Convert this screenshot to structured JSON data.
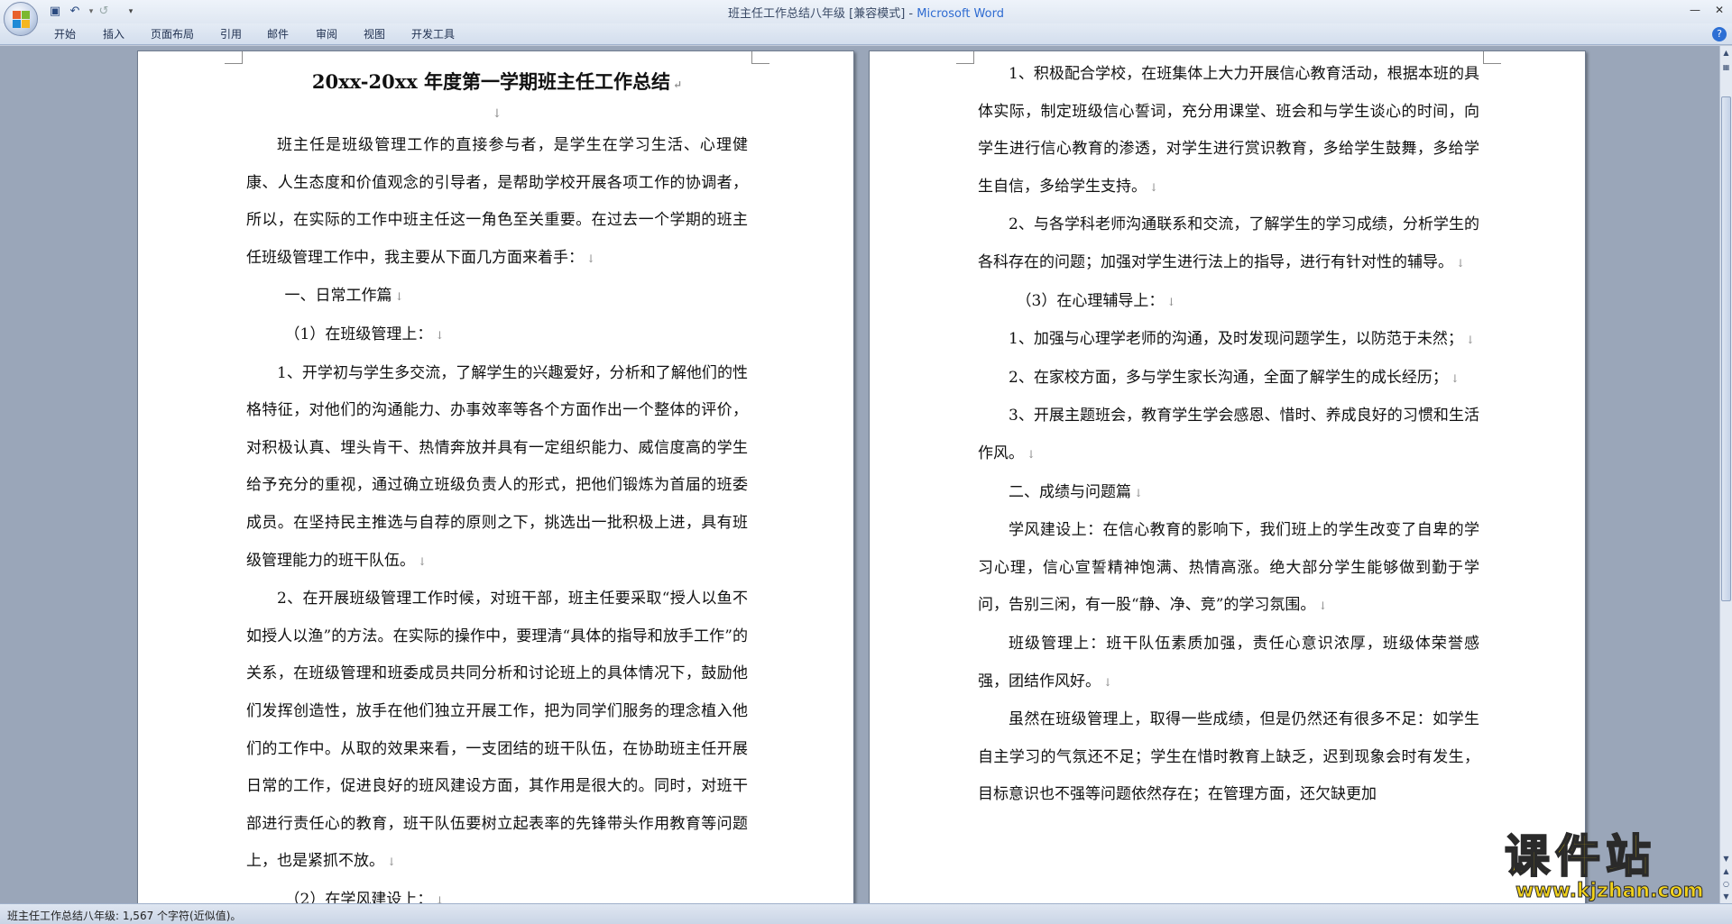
{
  "window": {
    "title": "班主任工作总结八年级 [兼容模式] - ",
    "app_name": "Microsoft Word"
  },
  "quick_access": {
    "save_icon": "save-icon",
    "undo_icon": "undo-icon",
    "redo_icon": "redo-icon",
    "customize_icon": "dropdown-icon"
  },
  "ribbon_tabs": [
    "开始",
    "插入",
    "页面布局",
    "引用",
    "邮件",
    "审阅",
    "视图",
    "开发工具"
  ],
  "page1": {
    "title": "20xx-20xx 年度第一学期班主任工作总结",
    "paragraphs": [
      "班主任是班级管理工作的直接参与者，是学生在学习生活、心理健康、人生态度和价值观念的引导者，是帮助学校开展各项工作的协调者，所以，在实际的工作中班主任这一角色至关重要。在过去一个学期的班主任班级管理工作中，我主要从下面几方面来着手：",
      "一、日常工作篇",
      "（1）在班级管理上：",
      "1、开学初与学生多交流，了解学生的兴趣爱好，分析和了解他们的性格特征，对他们的沟通能力、办事效率等各个方面作出一个整体的评价，对积极认真、埋头肯干、热情奔放并具有一定组织能力、威信度高的学生给予充分的重视，通过确立班级负责人的形式，把他们锻炼为首届的班委成员。在坚持民主推选与自荐的原则之下，挑选出一批积极上进，具有班级管理能力的班干队伍。",
      "2、在开展班级管理工作时候，对班干部，班主任要采取“授人以鱼不如授人以渔”的方法。在实际的操作中，要理清“具体的指导和放手工作”的关系，在班级管理和班委成员共同分析和讨论班上的具体情况下，鼓励他们发挥创造性，放手在他们独立开展工作，把为同学们服务的理念植入他们的工作中。从取的效果来看，一支团结的班干队伍，在协助班主任开展日常的工作，促进良好的班风建设方面，其作用是很大的。同时，对班干部进行责任心的教育，班干队伍要树立起表率的先锋带头作用教育等问题上，也是紧抓不放。",
      "（2）在学风建设上："
    ]
  },
  "page2": {
    "paragraphs": [
      "1、积极配合学校，在班集体上大力开展信心教育活动，根据本班的具体实际，制定班级信心誓词，充分用课堂、班会和与学生谈心的时间，向学生进行信心教育的渗透，对学生进行赏识教育，多给学生鼓舞，多给学生自信，多给学生支持。",
      "2、与各学科老师沟通联系和交流，了解学生的学习成绩，分析学生的各科存在的问题；加强对学生进行法上的指导，进行有针对性的辅导。",
      "（3）在心理辅导上：",
      "1、加强与心理学老师的沟通，及时发现问题学生，以防范于未然；",
      "2、在家校方面，多与学生家长沟通，全面了解学生的成长经历；",
      "3、开展主题班会，教育学生学会感恩、惜时、养成良好的习惯和生活作风。",
      "二、成绩与问题篇",
      "学风建设上：在信心教育的影响下，我们班上的学生改变了自卑的学习心理，信心宣誓精神饱满、热情高涨。绝大部分学生能够做到勤于学问，告别三闲，有一股“静、净、竞”的学习氛围。",
      "班级管理上：班干队伍素质加强，责任心意识浓厚，班级体荣誉感强，团结作风好。",
      "虽然在班级管理上，取得一些成绩，但是仍然还有很多不足：如学生自主学习的气氛还不足；学生在惜时教育上缺乏，迟到现象会时有发生，目标意识也不强等问题依然存在；在管理方面，还欠缺更加"
    ]
  },
  "status_bar": {
    "text": "班主任工作总结八年级: 1,567 个字符(近似值)。"
  },
  "watermark": {
    "main": "课件站",
    "url": "www.kjzhan.com"
  },
  "colors": {
    "app_name": "#2e6bd1",
    "watermark": "#f2d21b",
    "doc_background": "#9aa6b9"
  }
}
